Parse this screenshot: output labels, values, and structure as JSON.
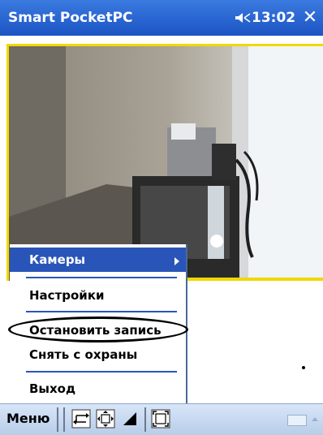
{
  "title_bar": {
    "app_title": "Smart PocketPC",
    "time": "13:02",
    "close_label": "✕"
  },
  "menu": {
    "items": [
      {
        "label": "Камеры",
        "selected": true,
        "has_submenu": true
      },
      {
        "label": "Настройки"
      },
      {
        "label": "Остановить запись",
        "highlighted_by_circle": true
      },
      {
        "label": "Снять с охраны"
      },
      {
        "label": "Выход"
      }
    ]
  },
  "toolbar": {
    "menu_label": "Меню",
    "icons": [
      "swap-icon",
      "fit-to-screen-icon",
      "signal-icon",
      "fullscreen-icon",
      "keyboard-icon"
    ]
  },
  "colors": {
    "title_bar": "#1c54c4",
    "menu_selected": "#2a55b8",
    "video_border": "#f0d800"
  }
}
